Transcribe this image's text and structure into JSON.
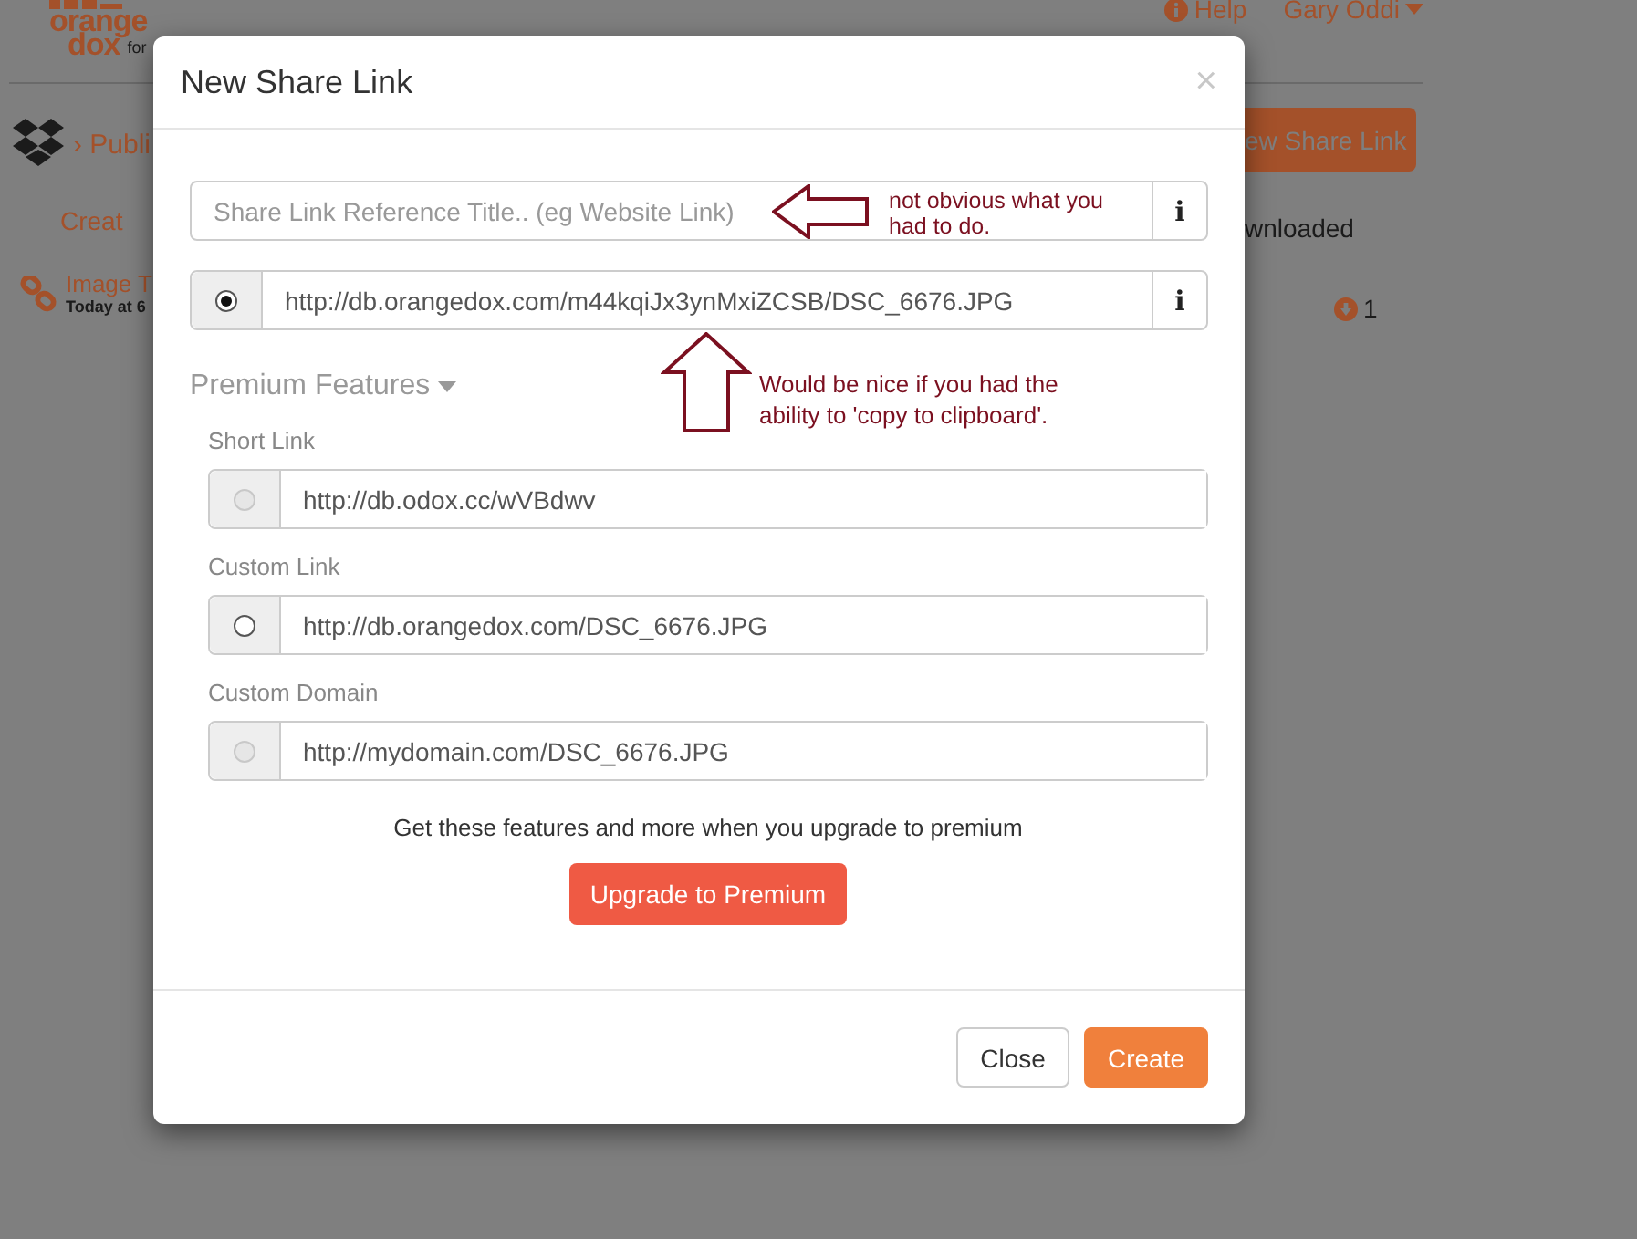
{
  "background_page": {
    "logo": {
      "word_1": "orange",
      "word_2": "dox",
      "tagline": "for"
    },
    "header": {
      "help": "Help",
      "user": "Gary Oddi"
    },
    "breadcrumb": "› Publi",
    "new_share_link_button": "ew Share Link",
    "info_text": "Creat",
    "column_heading": "wnloaded",
    "item": {
      "title": "Image T",
      "time": "Today at 6",
      "downloads": "1"
    }
  },
  "dialog": {
    "title": "New Share Link",
    "close": "×",
    "title_field": {
      "placeholder": "Share Link Reference Title.. (eg Website Link)",
      "info": "i"
    },
    "main_link": {
      "url": "http://db.orangedox.com/m44kqiJx3ynMxiZCSB/DSC_6676.JPG",
      "selected": true,
      "info": "i"
    },
    "premium": {
      "heading": "Premium Features",
      "expanded": true,
      "options": [
        {
          "label": "Short Link",
          "url": "http://db.odox.cc/wVBdwv",
          "selected": false,
          "disabled": true
        },
        {
          "label": "Custom Link",
          "url": "http://db.orangedox.com/DSC_6676.JPG",
          "selected": false,
          "disabled": false
        },
        {
          "label": "Custom Domain",
          "url": "http://mydomain.com/DSC_6676.JPG",
          "selected": false,
          "disabled": true
        }
      ],
      "note": "Get these features and more when you upgrade to premium",
      "upgrade_button": "Upgrade to Premium"
    },
    "buttons": [
      {
        "label": "Close",
        "kind": "default"
      },
      {
        "label": "Create",
        "kind": "primary"
      }
    ]
  },
  "annotations": [
    {
      "kind": "left",
      "text": "not obvious what you had to do."
    },
    {
      "kind": "up",
      "text": "Would be nice if you had the ability to 'copy to clipboard'."
    }
  ]
}
